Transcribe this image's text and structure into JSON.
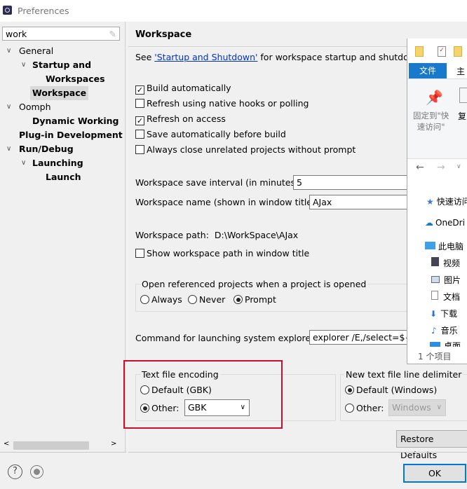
{
  "window": {
    "title": "Preferences"
  },
  "sidebar": {
    "search_value": "work",
    "items": [
      {
        "label": "General",
        "bold": false
      },
      {
        "label": "Startup and Shutdow",
        "bold": true
      },
      {
        "label": "Workspaces",
        "bold": true
      },
      {
        "label": "Workspace",
        "bold": true,
        "selected": true
      },
      {
        "label": "Oomph",
        "bold": false
      },
      {
        "label": "Dynamic Working S",
        "bold": true
      },
      {
        "label": "Plug-in Development",
        "bold": true
      },
      {
        "label": "Run/Debug",
        "bold": true
      },
      {
        "label": "Launching",
        "bold": true
      },
      {
        "label": "Launch Configur",
        "bold": true
      }
    ]
  },
  "main": {
    "title": "Workspace",
    "see_prefix": "See ",
    "see_link": "'Startup and Shutdown'",
    "see_suffix": " for workspace startup and shutdown p",
    "checkboxes": [
      {
        "label": "Build automatically",
        "checked": true
      },
      {
        "label": "Refresh using native hooks or polling",
        "checked": false
      },
      {
        "label": "Refresh on access",
        "checked": true
      },
      {
        "label": "Save automatically before build",
        "checked": false
      },
      {
        "label": "Always close unrelated projects without prompt",
        "checked": false
      }
    ],
    "save_interval_label": "Workspace save interval (in minutes):",
    "save_interval_value": "5",
    "name_label": "Workspace name (shown in window title):",
    "name_value": "AJax",
    "path_label": "Workspace path:",
    "path_value": "D:\\WorkSpace\\AJax",
    "show_path_label": "Show workspace path in window title",
    "open_ref_group": "Open referenced projects when a project is opened",
    "open_ref_options": [
      "Always",
      "Never",
      "Prompt"
    ],
    "open_ref_selected": "Prompt",
    "command_label": "Command for launching system explorer:",
    "command_value": "explorer /E,/select=${se",
    "encoding_group": "Text file encoding",
    "encoding_default": "Default (GBK)",
    "encoding_other": "Other:",
    "encoding_value": "GBK",
    "encoding_selected": "Other",
    "delimiter_group": "New text file line delimiter",
    "delimiter_default": "Default (Windows)",
    "delimiter_other": "Other:",
    "delimiter_value": "Windows",
    "delimiter_selected": "Default",
    "restore_defaults": "Restore Defaults"
  },
  "footer": {
    "ok": "OK"
  },
  "explorer": {
    "tab_file": "文件",
    "tab_home": "主",
    "pin_label_1": "固定到\"快",
    "pin_label_2": "速访问\"",
    "copy": "复",
    "nav": [
      "快速访问",
      "OneDri",
      "此电脑",
      "视频",
      "图片",
      "文档",
      "下载",
      "音乐",
      "桌面"
    ],
    "status": "1 个项目"
  },
  "colors": {
    "highlight_box": "#c8102e",
    "link": "#0033cc",
    "selected_item": "#d9d9d9",
    "explorer_tab": "#1979ca"
  }
}
